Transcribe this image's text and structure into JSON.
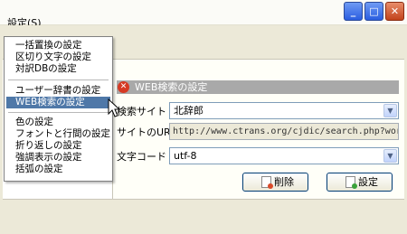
{
  "menubar": {
    "settings_label": "設定(",
    "settings_hotkey": "S",
    "settings_close": ")"
  },
  "window_buttons": {
    "minimize": "_",
    "maximize": "□",
    "close": "✕"
  },
  "menu": {
    "group1": [
      "一括置換の設定",
      "区切り文字の設定",
      "対訳DBの設定"
    ],
    "group2": [
      "ユーザー辞書の設定",
      "WEB検索の設定"
    ],
    "group3": [
      "色の設定",
      "フォントと行間の設定",
      "折り返しの設定",
      "強調表示の設定",
      "括弧の設定"
    ],
    "highlighted": "WEB検索の設定"
  },
  "section": {
    "title": "WEB検索の設定",
    "icon": "error-icon"
  },
  "form": {
    "search_site_label": "検索サイト",
    "search_site_value": "北辞郎",
    "site_url_label": "サイトのURL",
    "site_url_value": "http://www.ctrans.org/cjdic/search.php?word=%s",
    "charset_label": "文字コード",
    "charset_value": "utf-8"
  },
  "buttons": {
    "delete_label": "削除",
    "set_label": "設定"
  },
  "colors": {
    "highlight": "#4f78a8",
    "section_bar": "#a9a9a9",
    "xp_blue": "#2a5de0",
    "close_red": "#c2431b"
  }
}
